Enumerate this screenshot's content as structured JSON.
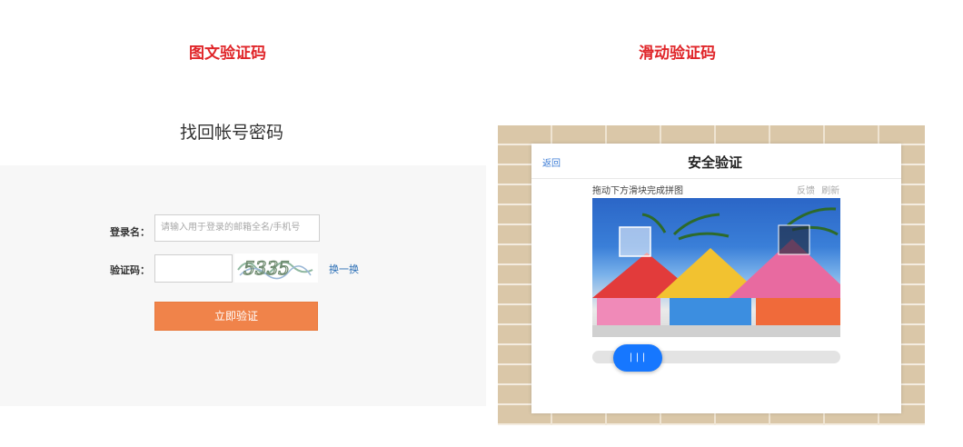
{
  "sections": {
    "image_captcha_title": "图文验证码",
    "slide_captcha_title": "滑动验证码"
  },
  "form": {
    "heading": "找回帐号密码",
    "login_label": "登录名：",
    "login_placeholder": "请输入用于登录的邮箱全名/手机号",
    "code_label": "验证码：",
    "code_value": "",
    "captcha_text": "5335",
    "refresh_label": "换一换",
    "submit_label": "立即验证"
  },
  "dialog": {
    "back_label": "返回",
    "title": "安全验证",
    "hint": "拖动下方滑块完成拼图",
    "feedback_label": "反馈",
    "refresh_label": "刷新",
    "slider_handle_label": "|||"
  },
  "colors": {
    "section_title": "#e0262a",
    "submit_button": "#f0834a",
    "link": "#2b6fb6",
    "slider_handle": "#1677ff"
  },
  "icons": {
    "slider_handle": "grip-lines-icon"
  }
}
